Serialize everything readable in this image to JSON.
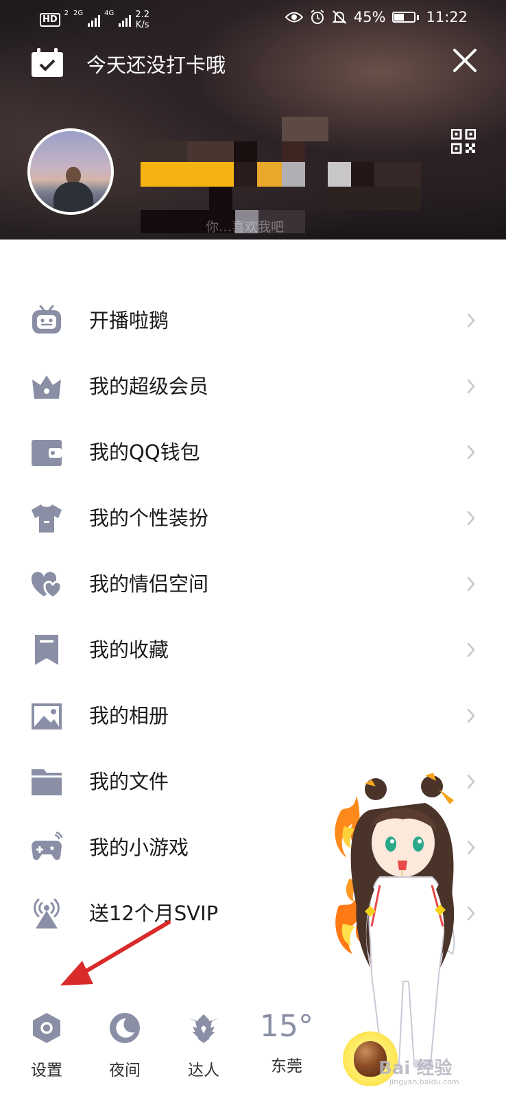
{
  "status_bar": {
    "hd_label": "HD",
    "hd_sub": "2",
    "sig1_label": "2G",
    "sig2_label": "4G",
    "speed_value": "2.2",
    "speed_unit": "K/s",
    "battery_text": "45%",
    "time": "11:22"
  },
  "header": {
    "checkin_text": "今天还没打卡哦",
    "signature": "你…喜欢我吧"
  },
  "menu": {
    "items": [
      {
        "label": "开播啦鹅",
        "icon": "tv-robot-icon"
      },
      {
        "label": "我的超级会员",
        "icon": "crown-icon"
      },
      {
        "label": "我的QQ钱包",
        "icon": "wallet-icon"
      },
      {
        "label": "我的个性装扮",
        "icon": "tshirt-icon"
      },
      {
        "label": "我的情侣空间",
        "icon": "hearts-icon"
      },
      {
        "label": "我的收藏",
        "icon": "bookmark-icon"
      },
      {
        "label": "我的相册",
        "icon": "picture-icon"
      },
      {
        "label": "我的文件",
        "icon": "folder-icon"
      },
      {
        "label": "我的小游戏",
        "icon": "gamepad-icon"
      },
      {
        "label": "送12个月SVIP",
        "icon": "antenna-icon"
      }
    ]
  },
  "bottom_bar": {
    "settings_label": "设置",
    "night_label": "夜间",
    "expert_label": "达人",
    "weather_temp": "15°",
    "weather_city": "东莞"
  },
  "watermark": {
    "text": "Bai 经验",
    "sub": "jingyan.baidu.com"
  },
  "colors": {
    "icon_gray": "#8a8fa6",
    "chevron": "#c4c6d0",
    "arrow_red": "#d92b2b",
    "label_text": "#1a1a1a"
  }
}
